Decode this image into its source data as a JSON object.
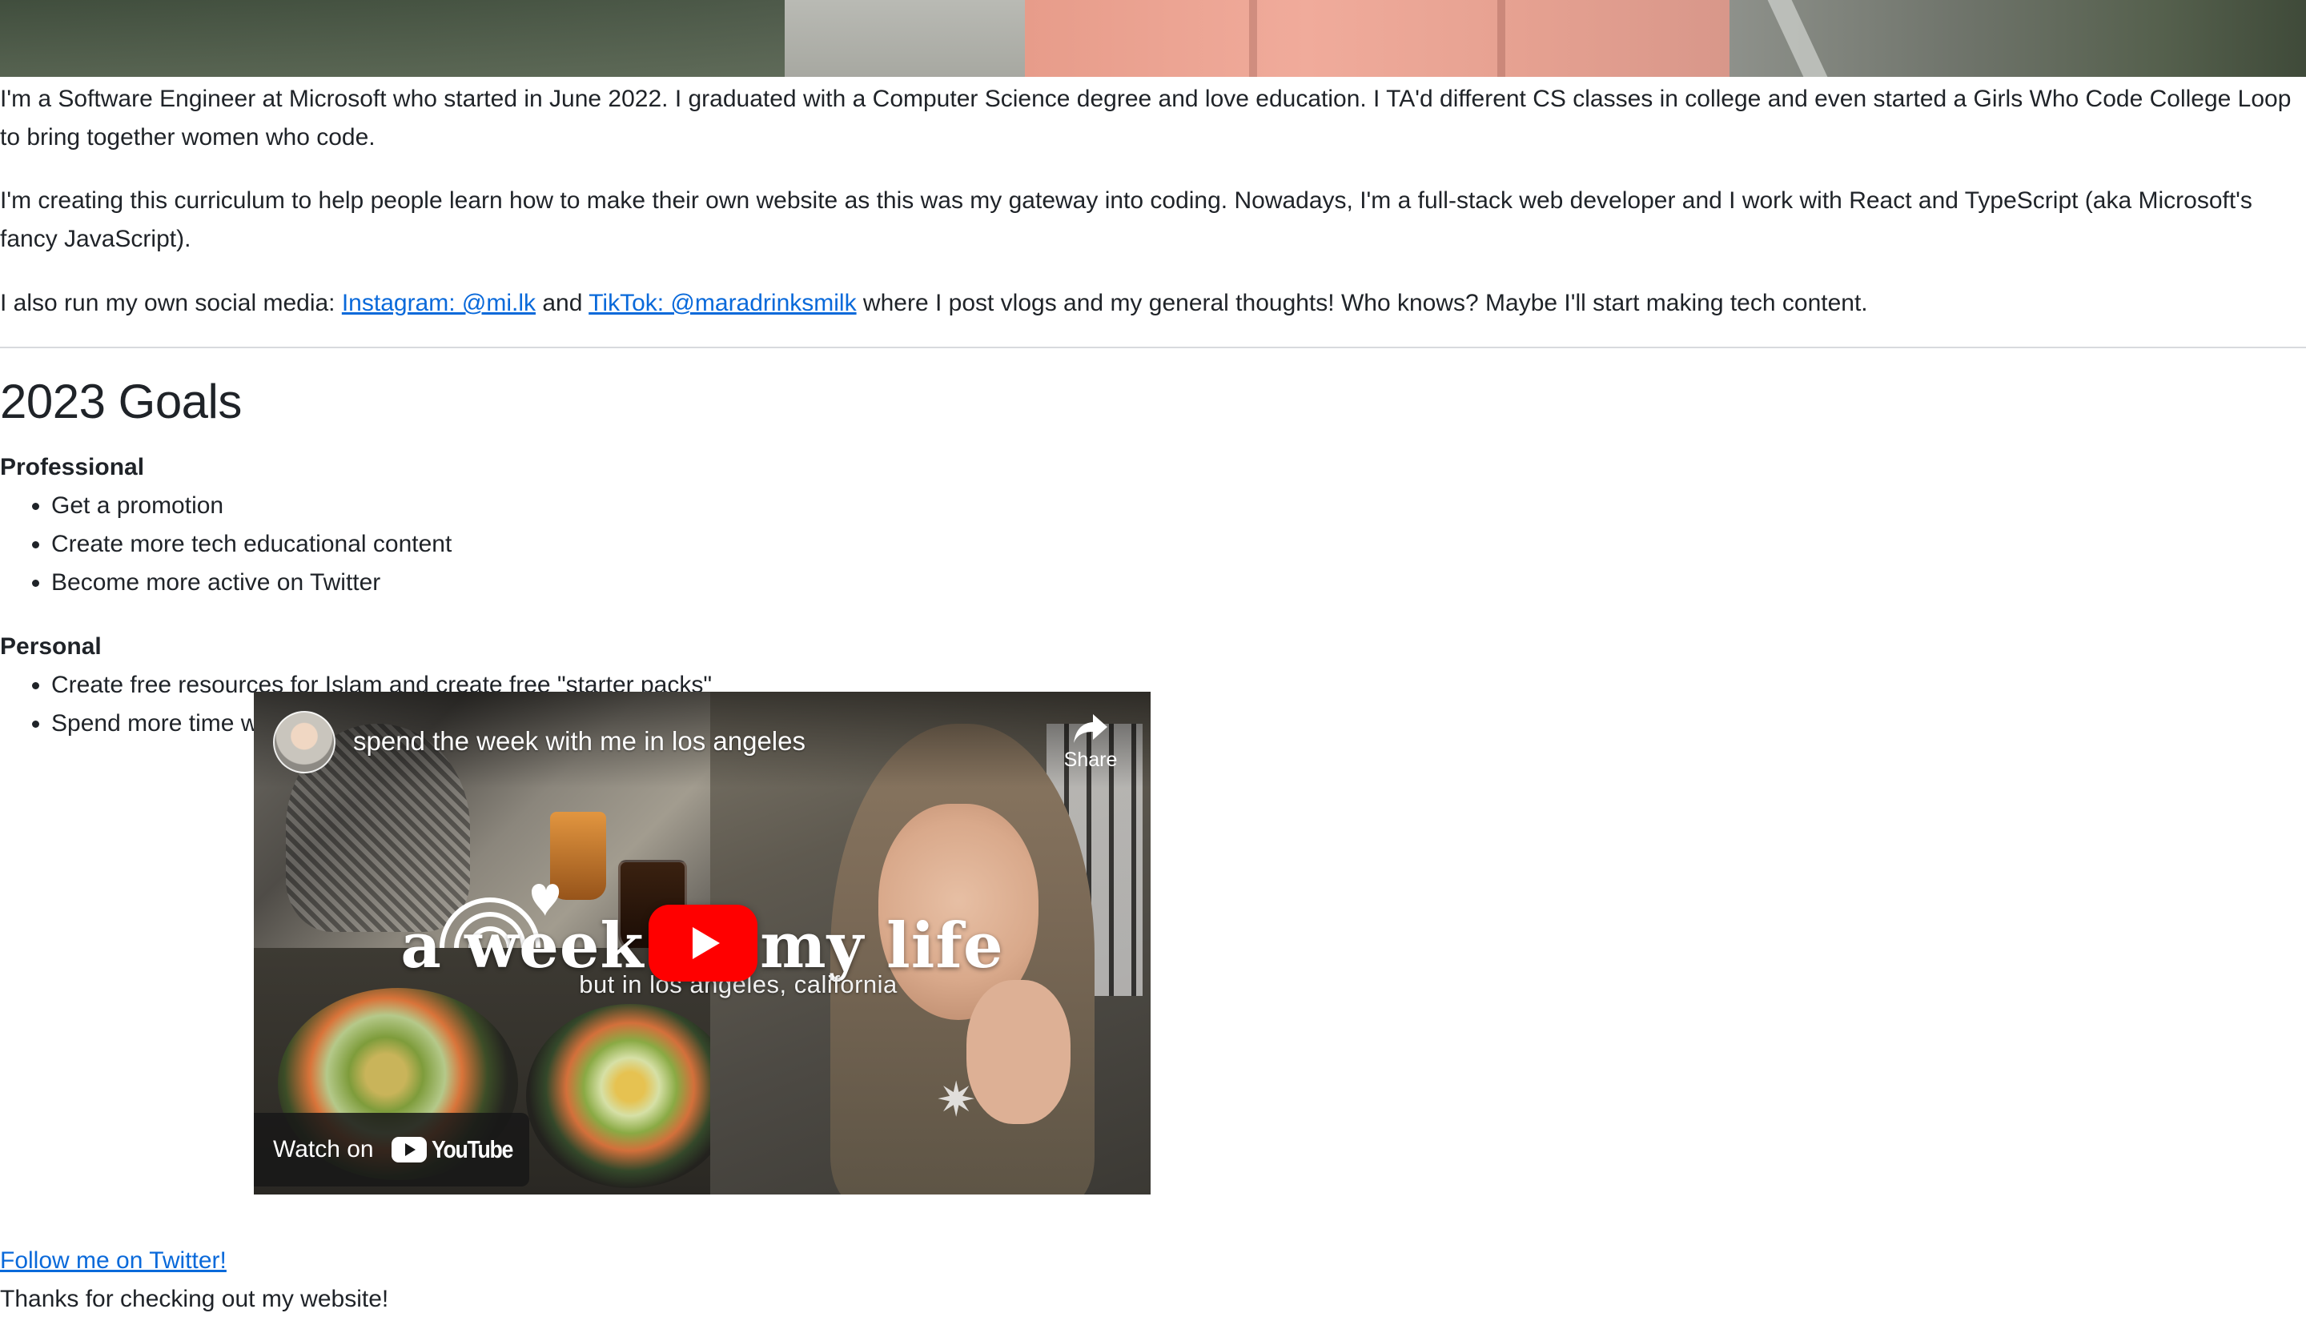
{
  "about": {
    "paragraph1": "I'm a Software Engineer at Microsoft who started in June 2022. I graduated with a Computer Science degree and love education. I TA'd different CS classes in college and even started a Girls Who Code College Loop to bring together women who code.",
    "paragraph2": "I'm creating this curriculum to help people learn how to make their own website as this was my gateway into coding. Nowadays, I'm a full-stack web developer and I work with React and TypeScript (aka Microsoft's fancy JavaScript).",
    "social_prefix": "I also run my own social media: ",
    "instagram_link": "Instagram: @mi.lk",
    "social_and": " and ",
    "tiktok_link": "TikTok: @maradrinksmilk",
    "social_suffix": " where I post vlogs and my general thoughts! Who knows? Maybe I'll start making tech content."
  },
  "goals": {
    "title": "2023 Goals",
    "professional_label": "Professional",
    "professional": [
      "Get a promotion",
      "Create more tech educational content",
      "Become more active on Twitter"
    ],
    "personal_label": "Personal",
    "personal": [
      "Create free resources for Islam and create free \"starter packs\"",
      "Spend more time with friends and family. At least one outing a week."
    ]
  },
  "video": {
    "title": "spend the week with me in los angeles",
    "share_label": "Share",
    "overlay_title": "a week in my life",
    "overlay_subtitle": "but in los angeles, california",
    "watch_on_label": "Watch on",
    "youtube_wordmark": "YouTube"
  },
  "footer": {
    "twitter_link": "Follow me on Twitter!",
    "thanks": "Thanks for checking out my website!"
  },
  "colors": {
    "link": "#0969da",
    "text": "#1f2328",
    "youtube_red": "#ff0000",
    "divider": "#d8dadd"
  }
}
